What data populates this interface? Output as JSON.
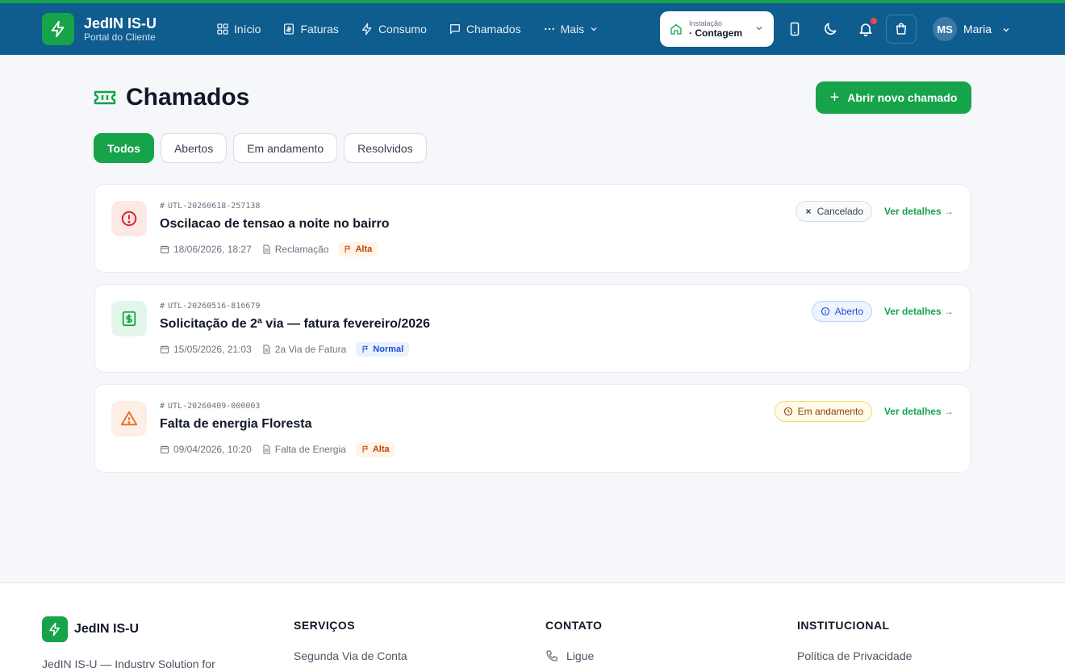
{
  "header": {
    "brand_name": "JedIN IS-U",
    "brand_sub": "Portal do Cliente",
    "nav": [
      {
        "label": "Início",
        "icon": "grid-icon"
      },
      {
        "label": "Faturas",
        "icon": "receipt-icon"
      },
      {
        "label": "Consumo",
        "icon": "bolt-icon"
      },
      {
        "label": "Chamados",
        "icon": "message-icon"
      },
      {
        "label": "Mais",
        "icon": "more-icon"
      }
    ],
    "installation_label": "Instalação",
    "installation_value": "· Contagem",
    "user_initials": "MS",
    "user_name": "Maria",
    "has_notification": true
  },
  "page": {
    "title": "Chamados",
    "new_button": "Abrir novo chamado",
    "filters": [
      "Todos",
      "Abertos",
      "Em andamento",
      "Resolvidos"
    ],
    "active_filter": "Todos"
  },
  "tickets": [
    {
      "id": "UTL-20260618-257138",
      "title": "Oscilacao de tensao a noite no bairro",
      "date": "18/06/2026, 18:27",
      "type": "Reclamação",
      "priority": "Alta",
      "status": "Cancelado",
      "details": "Ver detalhes",
      "icon": "alert-circle-icon"
    },
    {
      "id": "UTL-20260516-816679",
      "title": "Solicitação de 2ª via — fatura fevereiro/2026",
      "date": "15/05/2026, 21:03",
      "type": "2a Via de Fatura",
      "priority": "Normal",
      "status": "Aberto",
      "details": "Ver detalhes",
      "icon": "dollar-receipt-icon"
    },
    {
      "id": "UTL-20260409-000003",
      "title": "Falta de energia Floresta",
      "date": "09/04/2026, 10:20",
      "type": "Falta de Energia",
      "priority": "Alta",
      "status": "Em andamento",
      "details": "Ver detalhes",
      "icon": "warning-triangle-icon"
    }
  ],
  "footer": {
    "brand_name": "JedIN IS-U",
    "description": "JedIN IS-U — Industry Solution for",
    "columns": [
      {
        "title": "SERVIÇOS",
        "first_link": "Segunda Via de Conta"
      },
      {
        "title": "CONTATO",
        "first_link": "Ligue"
      },
      {
        "title": "INSTITUCIONAL",
        "first_link": "Política de Privacidade"
      }
    ]
  },
  "colors": {
    "header_bg": "#0f5c8f",
    "accent_green": "#16a34a",
    "page_bg": "#f5f7fa"
  }
}
